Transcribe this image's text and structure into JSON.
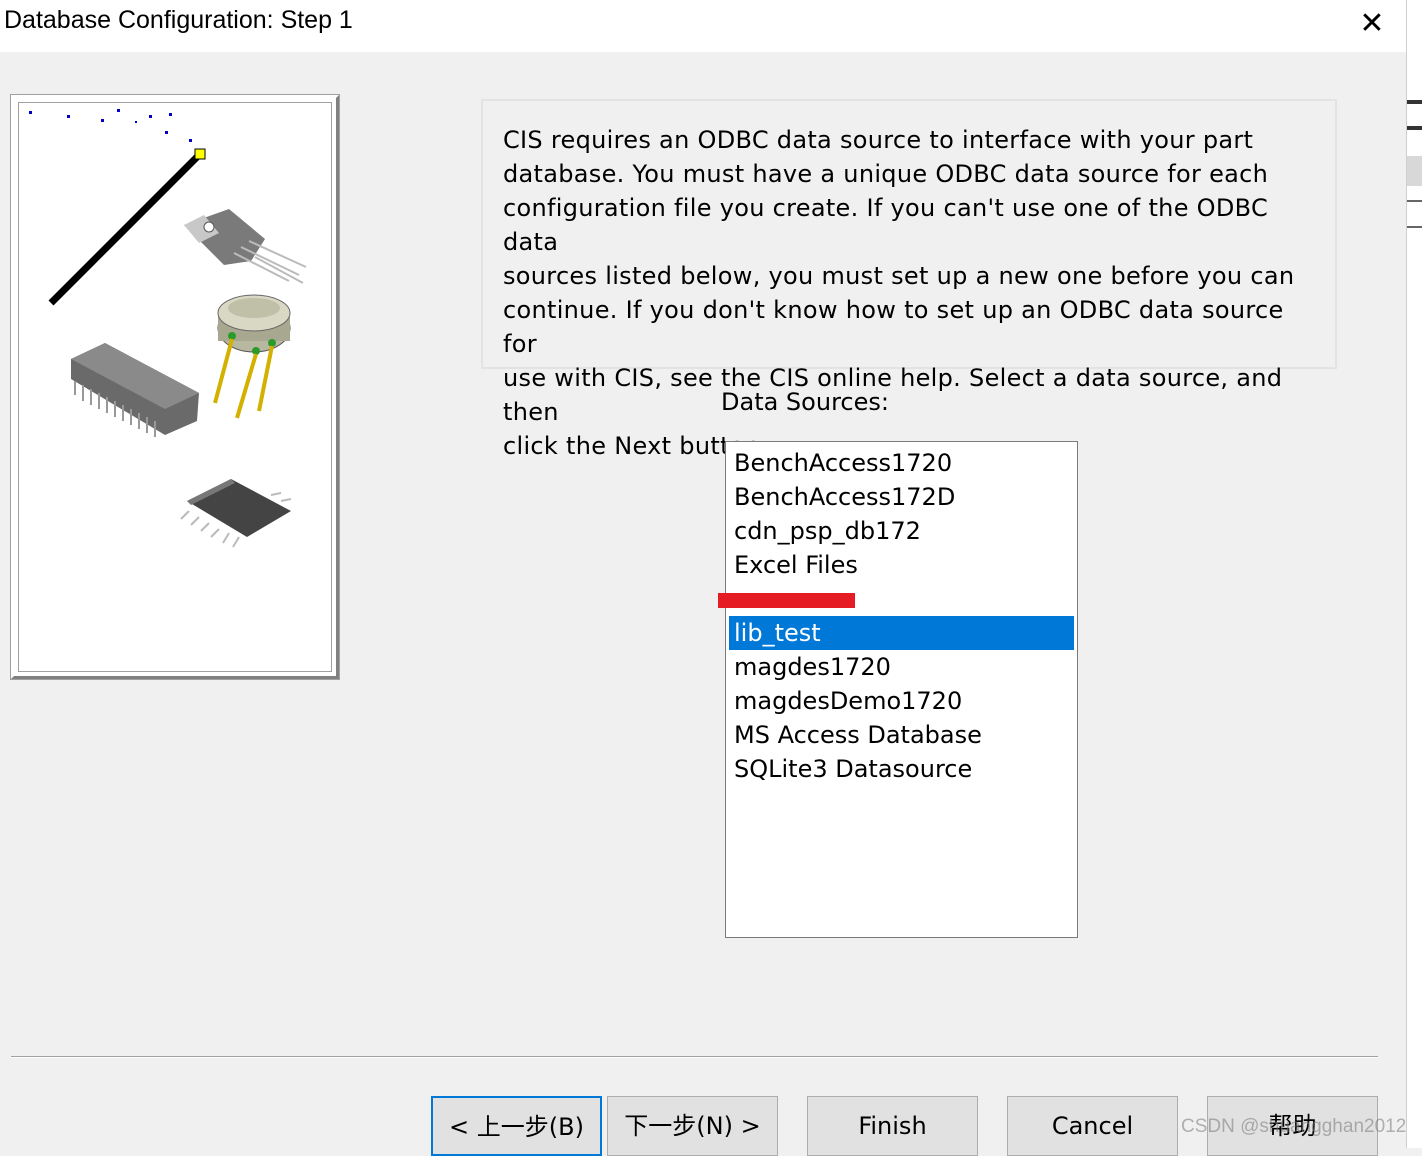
{
  "window": {
    "title": "Database Configuration: Step 1",
    "close_icon": "close-icon",
    "close_glyph": "✕"
  },
  "illustration": {
    "icon": "wizard-wand-components-illustration"
  },
  "description": "CIS requires an ODBC data source to interface with your part\ndatabase. You must have a unique ODBC data source for each\nconfiguration file you create. If you can't use one of the ODBC data\nsources listed below, you must set up a new one before you can\ncontinue. If you don't know how to set up an ODBC data source for\nuse with CIS, see the CIS online help.  Select a data source, and then\nclick the Next button.",
  "data_sources": {
    "label": "Data Sources:",
    "items": [
      "BenchAccess1720",
      "BenchAccess172D",
      "cdn_psp_db172",
      "Excel Files",
      "",
      "lib_test",
      "magdes1720",
      "magdesDemo1720",
      "MS Access Database",
      "SQLite3 Datasource"
    ],
    "selected": "lib_test"
  },
  "buttons": {
    "back": "< 上一步(B)",
    "next": "下一步(N) >",
    "finish": "Finish",
    "cancel": "Cancel",
    "help": "帮助"
  },
  "watermark": "CSDN @shuangghan2012",
  "colors": {
    "selection": "#0078d7",
    "redaction": "#e51c23",
    "dialog_bg": "#f0f0f0"
  }
}
